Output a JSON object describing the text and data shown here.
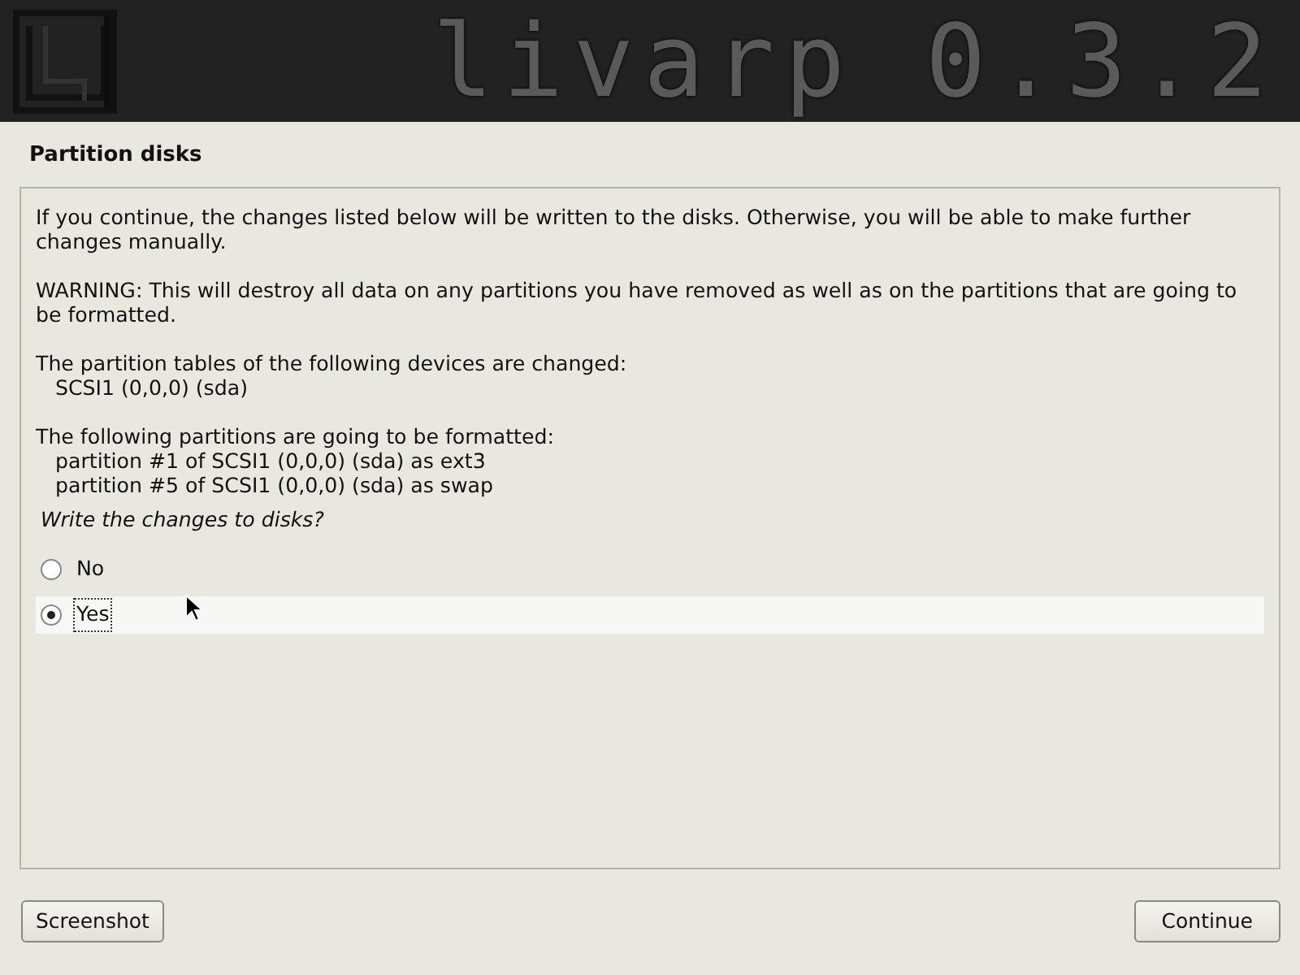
{
  "banner": {
    "title": "livarp 0.3.2"
  },
  "page_title": "Partition disks",
  "message": [
    {
      "text": "If you continue, the changes listed below will be written to the disks. Otherwise, you will be able to make further changes manually."
    },
    {
      "text": "WARNING: This will destroy all data on any partitions you have removed as well as on the partitions that are going to be formatted."
    },
    {
      "text": "The partition tables of the following devices are changed:",
      "children": [
        {
          "text": "SCSI1 (0,0,0) (sda)"
        }
      ]
    },
    {
      "text": "The following partitions are going to be formatted:",
      "children": [
        {
          "text": "partition #1 of SCSI1 (0,0,0) (sda) as ext3"
        },
        {
          "text": "partition #5 of SCSI1 (0,0,0) (sda) as swap"
        }
      ]
    }
  ],
  "question": "Write the changes to disks?",
  "options": [
    {
      "label": "No",
      "selected": false
    },
    {
      "label": "Yes",
      "selected": true
    }
  ],
  "buttons": [
    {
      "label": "Screenshot"
    },
    {
      "label": "Continue"
    }
  ]
}
